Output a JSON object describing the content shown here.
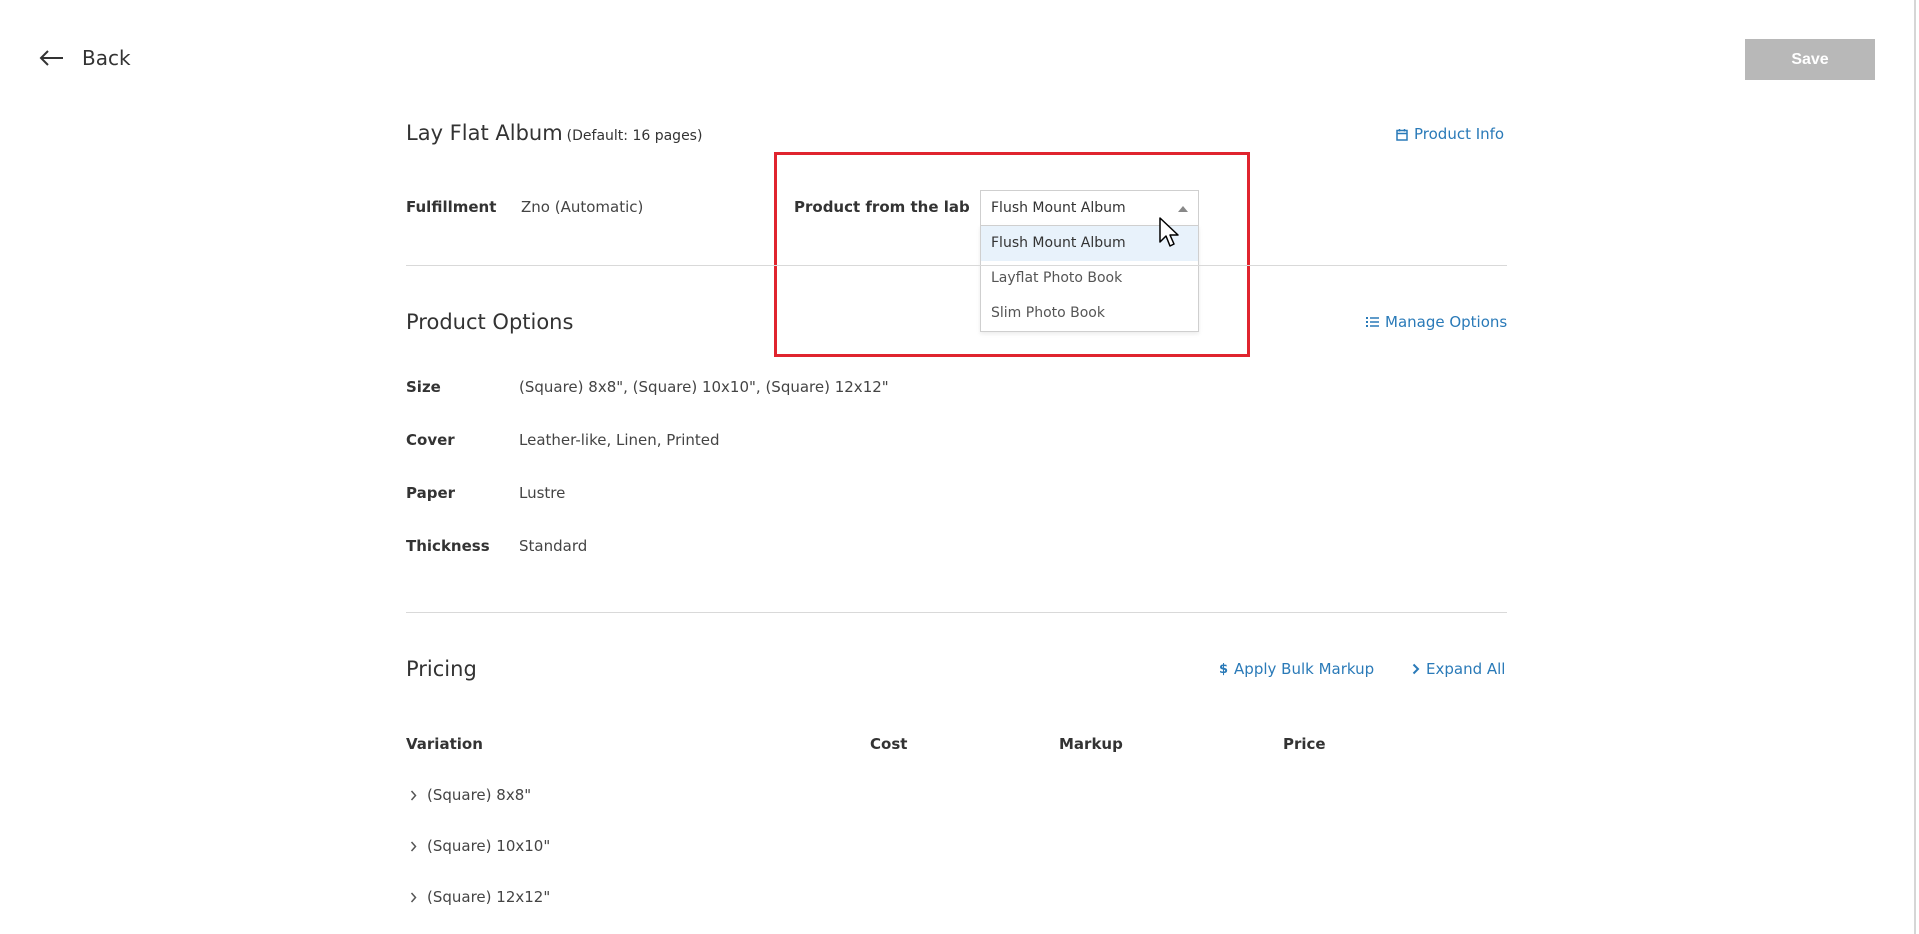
{
  "header": {
    "back_label": "Back",
    "save_label": "Save"
  },
  "product": {
    "title": "Lay Flat Album",
    "default_note": "(Default:  16 pages)",
    "info_link": "Product Info"
  },
  "fulfillment": {
    "label": "Fulfillment",
    "value": "Zno (Automatic)",
    "lab_label": "Product from the lab",
    "selected": "Flush Mount Album",
    "options": [
      "Flush Mount Album",
      "Layflat Photo Book",
      "Slim Photo Book"
    ]
  },
  "product_options": {
    "title": "Product Options",
    "manage_link": "Manage Options",
    "rows": [
      {
        "label": "Size",
        "value": "(Square) 8x8\", (Square) 10x10\", (Square) 12x12\""
      },
      {
        "label": "Cover",
        "value": "Leather-like, Linen, Printed"
      },
      {
        "label": "Paper",
        "value": "Lustre"
      },
      {
        "label": "Thickness",
        "value": "Standard"
      }
    ]
  },
  "pricing": {
    "title": "Pricing",
    "bulk_markup_link": "Apply Bulk Markup",
    "expand_link": "Expand All",
    "columns": [
      "Variation",
      "Cost",
      "Markup",
      "Price"
    ],
    "variations": [
      "(Square) 8x8\"",
      "(Square) 10x10\"",
      "(Square) 12x12\""
    ]
  },
  "colors": {
    "accent": "#2a7ab8",
    "highlight": "#e0242e",
    "save_disabled": "#b8b8b8"
  }
}
